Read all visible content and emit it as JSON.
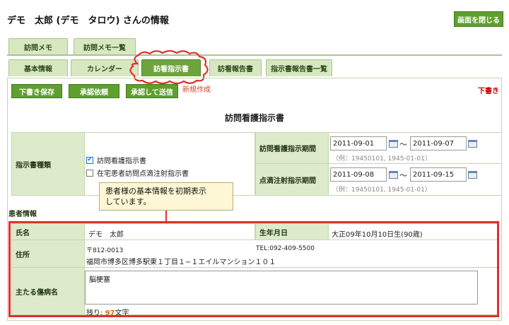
{
  "header": {
    "title": "デモ　太郎 (デモ　タロウ) さんの情報",
    "close_label": "画面を閉じる"
  },
  "tabs_top": [
    {
      "label": "訪問メモ"
    },
    {
      "label": "訪問メモ一覧"
    }
  ],
  "tabs_main": [
    {
      "label": "基本情報"
    },
    {
      "label": "カレンダー"
    },
    {
      "label": "訪看指示書",
      "active": true
    },
    {
      "label": "訪看報告書"
    },
    {
      "label": "指示書報告書一覧"
    }
  ],
  "actions": {
    "draft_save": "下書き保存",
    "request_approval": "承認依頼",
    "approve_send": "承認して送信",
    "new_label": "新規作成",
    "draft_status": "下書き"
  },
  "form": {
    "title": "訪問看護指示書",
    "type_label": "指示書種類",
    "option1": "訪問看護指示書",
    "option2": "在宅患者訪問点滴注射指示書",
    "period_label": "訪問看護指示期間",
    "period_from": "2011-09-01",
    "period_to": "2011-09-07",
    "drip_label": "点滴注射指示期間",
    "drip_from": "2011-09-08",
    "drip_to": "2011-09-15",
    "tilde": "〜",
    "example": "（例：19450101, 1945-01-01）"
  },
  "patient": {
    "section_label": "患者情報",
    "name_label": "氏名",
    "name": "デモ　太郎",
    "dob_label": "生年月日",
    "dob": "大正09年10月10日生(90歳)",
    "address_label": "住所",
    "postal": "〒812-0013",
    "tel": "TEL:092-409-5500",
    "address": "福岡市博多区博多駅東１丁目１−１エイルマンション１０１",
    "disease_label": "主たる傷病名",
    "disease": "脳梗塞",
    "remaining_prefix": "残り: ",
    "remaining_count": "97",
    "remaining_suffix": "文字"
  },
  "tooltip": {
    "line1": "患者様の基本情報を初期表示",
    "line2": "しています。"
  },
  "colors": {
    "accent": "#5f9f2d",
    "label_bg": "#ddeacc",
    "highlight": "#e0312a"
  }
}
